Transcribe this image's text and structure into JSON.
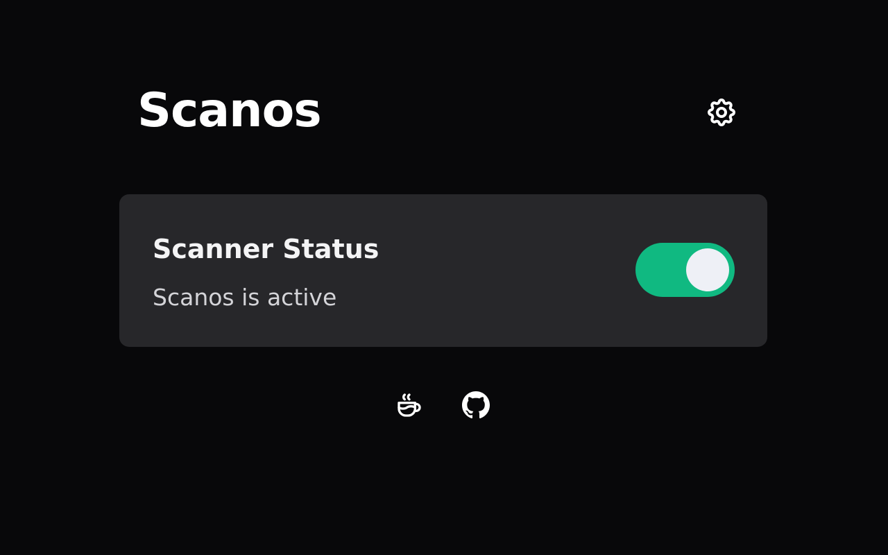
{
  "app": {
    "title": "Scanos"
  },
  "card": {
    "title": "Scanner Status",
    "status_text": "Scanos is active",
    "toggle_on": true,
    "toggle_color": "#10b981"
  },
  "icons": {
    "settings": "gear-icon",
    "donate": "coffee-icon",
    "repo": "github-icon"
  },
  "colors": {
    "background": "#08080a",
    "card": "#27272a",
    "accent": "#10b981"
  }
}
